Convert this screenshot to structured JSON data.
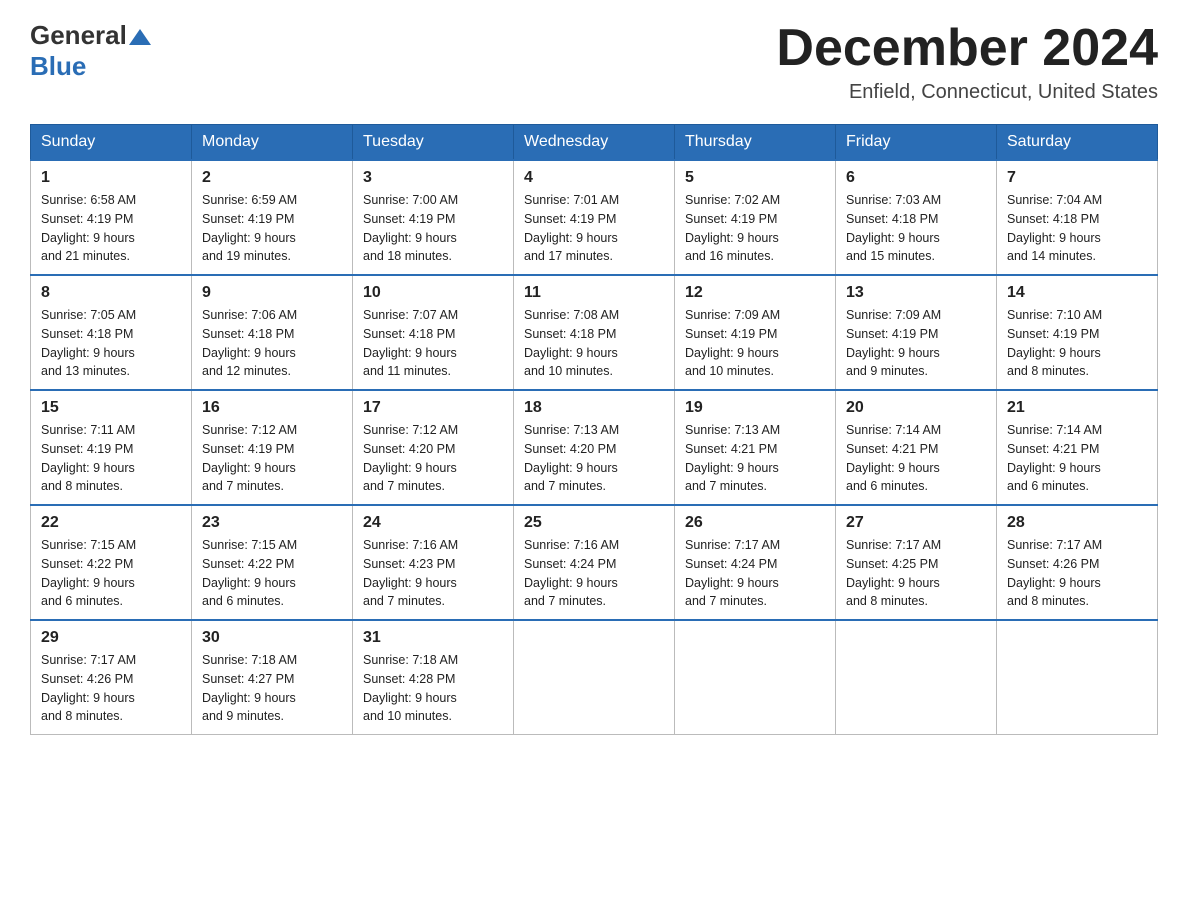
{
  "header": {
    "logo_general": "General",
    "logo_blue": "Blue",
    "month_title": "December 2024",
    "location": "Enfield, Connecticut, United States"
  },
  "days_of_week": [
    "Sunday",
    "Monday",
    "Tuesday",
    "Wednesday",
    "Thursday",
    "Friday",
    "Saturday"
  ],
  "weeks": [
    [
      {
        "day": "1",
        "sunrise": "6:58 AM",
        "sunset": "4:19 PM",
        "daylight": "9 hours and 21 minutes."
      },
      {
        "day": "2",
        "sunrise": "6:59 AM",
        "sunset": "4:19 PM",
        "daylight": "9 hours and 19 minutes."
      },
      {
        "day": "3",
        "sunrise": "7:00 AM",
        "sunset": "4:19 PM",
        "daylight": "9 hours and 18 minutes."
      },
      {
        "day": "4",
        "sunrise": "7:01 AM",
        "sunset": "4:19 PM",
        "daylight": "9 hours and 17 minutes."
      },
      {
        "day": "5",
        "sunrise": "7:02 AM",
        "sunset": "4:19 PM",
        "daylight": "9 hours and 16 minutes."
      },
      {
        "day": "6",
        "sunrise": "7:03 AM",
        "sunset": "4:18 PM",
        "daylight": "9 hours and 15 minutes."
      },
      {
        "day": "7",
        "sunrise": "7:04 AM",
        "sunset": "4:18 PM",
        "daylight": "9 hours and 14 minutes."
      }
    ],
    [
      {
        "day": "8",
        "sunrise": "7:05 AM",
        "sunset": "4:18 PM",
        "daylight": "9 hours and 13 minutes."
      },
      {
        "day": "9",
        "sunrise": "7:06 AM",
        "sunset": "4:18 PM",
        "daylight": "9 hours and 12 minutes."
      },
      {
        "day": "10",
        "sunrise": "7:07 AM",
        "sunset": "4:18 PM",
        "daylight": "9 hours and 11 minutes."
      },
      {
        "day": "11",
        "sunrise": "7:08 AM",
        "sunset": "4:18 PM",
        "daylight": "9 hours and 10 minutes."
      },
      {
        "day": "12",
        "sunrise": "7:09 AM",
        "sunset": "4:19 PM",
        "daylight": "9 hours and 10 minutes."
      },
      {
        "day": "13",
        "sunrise": "7:09 AM",
        "sunset": "4:19 PM",
        "daylight": "9 hours and 9 minutes."
      },
      {
        "day": "14",
        "sunrise": "7:10 AM",
        "sunset": "4:19 PM",
        "daylight": "9 hours and 8 minutes."
      }
    ],
    [
      {
        "day": "15",
        "sunrise": "7:11 AM",
        "sunset": "4:19 PM",
        "daylight": "9 hours and 8 minutes."
      },
      {
        "day": "16",
        "sunrise": "7:12 AM",
        "sunset": "4:19 PM",
        "daylight": "9 hours and 7 minutes."
      },
      {
        "day": "17",
        "sunrise": "7:12 AM",
        "sunset": "4:20 PM",
        "daylight": "9 hours and 7 minutes."
      },
      {
        "day": "18",
        "sunrise": "7:13 AM",
        "sunset": "4:20 PM",
        "daylight": "9 hours and 7 minutes."
      },
      {
        "day": "19",
        "sunrise": "7:13 AM",
        "sunset": "4:21 PM",
        "daylight": "9 hours and 7 minutes."
      },
      {
        "day": "20",
        "sunrise": "7:14 AM",
        "sunset": "4:21 PM",
        "daylight": "9 hours and 6 minutes."
      },
      {
        "day": "21",
        "sunrise": "7:14 AM",
        "sunset": "4:21 PM",
        "daylight": "9 hours and 6 minutes."
      }
    ],
    [
      {
        "day": "22",
        "sunrise": "7:15 AM",
        "sunset": "4:22 PM",
        "daylight": "9 hours and 6 minutes."
      },
      {
        "day": "23",
        "sunrise": "7:15 AM",
        "sunset": "4:22 PM",
        "daylight": "9 hours and 6 minutes."
      },
      {
        "day": "24",
        "sunrise": "7:16 AM",
        "sunset": "4:23 PM",
        "daylight": "9 hours and 7 minutes."
      },
      {
        "day": "25",
        "sunrise": "7:16 AM",
        "sunset": "4:24 PM",
        "daylight": "9 hours and 7 minutes."
      },
      {
        "day": "26",
        "sunrise": "7:17 AM",
        "sunset": "4:24 PM",
        "daylight": "9 hours and 7 minutes."
      },
      {
        "day": "27",
        "sunrise": "7:17 AM",
        "sunset": "4:25 PM",
        "daylight": "9 hours and 8 minutes."
      },
      {
        "day": "28",
        "sunrise": "7:17 AM",
        "sunset": "4:26 PM",
        "daylight": "9 hours and 8 minutes."
      }
    ],
    [
      {
        "day": "29",
        "sunrise": "7:17 AM",
        "sunset": "4:26 PM",
        "daylight": "9 hours and 8 minutes."
      },
      {
        "day": "30",
        "sunrise": "7:18 AM",
        "sunset": "4:27 PM",
        "daylight": "9 hours and 9 minutes."
      },
      {
        "day": "31",
        "sunrise": "7:18 AM",
        "sunset": "4:28 PM",
        "daylight": "9 hours and 10 minutes."
      },
      null,
      null,
      null,
      null
    ]
  ],
  "labels": {
    "sunrise": "Sunrise:",
    "sunset": "Sunset:",
    "daylight": "Daylight:"
  }
}
